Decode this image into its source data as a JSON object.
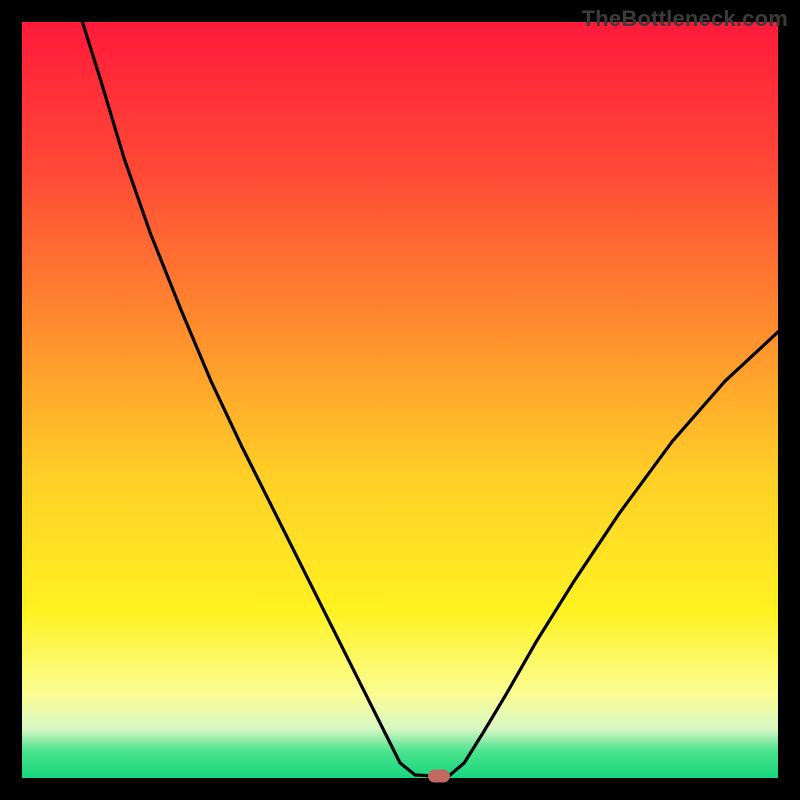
{
  "watermark": "TheBottleneck.com",
  "chart_data": {
    "type": "line",
    "title": "",
    "xlabel": "",
    "ylabel": "",
    "xlim": [
      0,
      100
    ],
    "ylim": [
      0,
      100
    ],
    "grid": false,
    "legend": false,
    "gradient_stops": [
      {
        "offset": 0.0,
        "color": "#ff1a3a"
      },
      {
        "offset": 0.2,
        "color": "#ff4a36"
      },
      {
        "offset": 0.4,
        "color": "#ff8b2e"
      },
      {
        "offset": 0.6,
        "color": "#ffcf27"
      },
      {
        "offset": 0.78,
        "color": "#fff222"
      },
      {
        "offset": 0.89,
        "color": "#fbfd95"
      },
      {
        "offset": 0.935,
        "color": "#d7f7c4"
      },
      {
        "offset": 0.965,
        "color": "#49e28c"
      },
      {
        "offset": 1.0,
        "color": "#16d87e"
      }
    ],
    "series": [
      {
        "name": "left-branch",
        "x": [
          8.0,
          10.5,
          13.5,
          17.0,
          21.0,
          25.0,
          29.0,
          33.0,
          37.0,
          41.0,
          44.5,
          47.5,
          50.0,
          52.0
        ],
        "y": [
          100.0,
          92.0,
          82.0,
          72.0,
          62.0,
          52.5,
          44.0,
          36.0,
          28.0,
          20.0,
          13.0,
          7.0,
          2.0,
          0.4
        ]
      },
      {
        "name": "valley-floor",
        "x": [
          52.0,
          54.0,
          56.5
        ],
        "y": [
          0.4,
          0.3,
          0.3
        ]
      },
      {
        "name": "right-branch",
        "x": [
          56.5,
          58.5,
          61.0,
          64.0,
          68.0,
          73.0,
          79.0,
          86.0,
          93.0,
          100.0
        ],
        "y": [
          0.3,
          2.0,
          6.0,
          11.0,
          18.0,
          26.0,
          35.0,
          44.5,
          52.5,
          59.0
        ]
      }
    ],
    "marker": {
      "x": 55.2,
      "y": 0.3,
      "color": "#c06a61"
    }
  }
}
